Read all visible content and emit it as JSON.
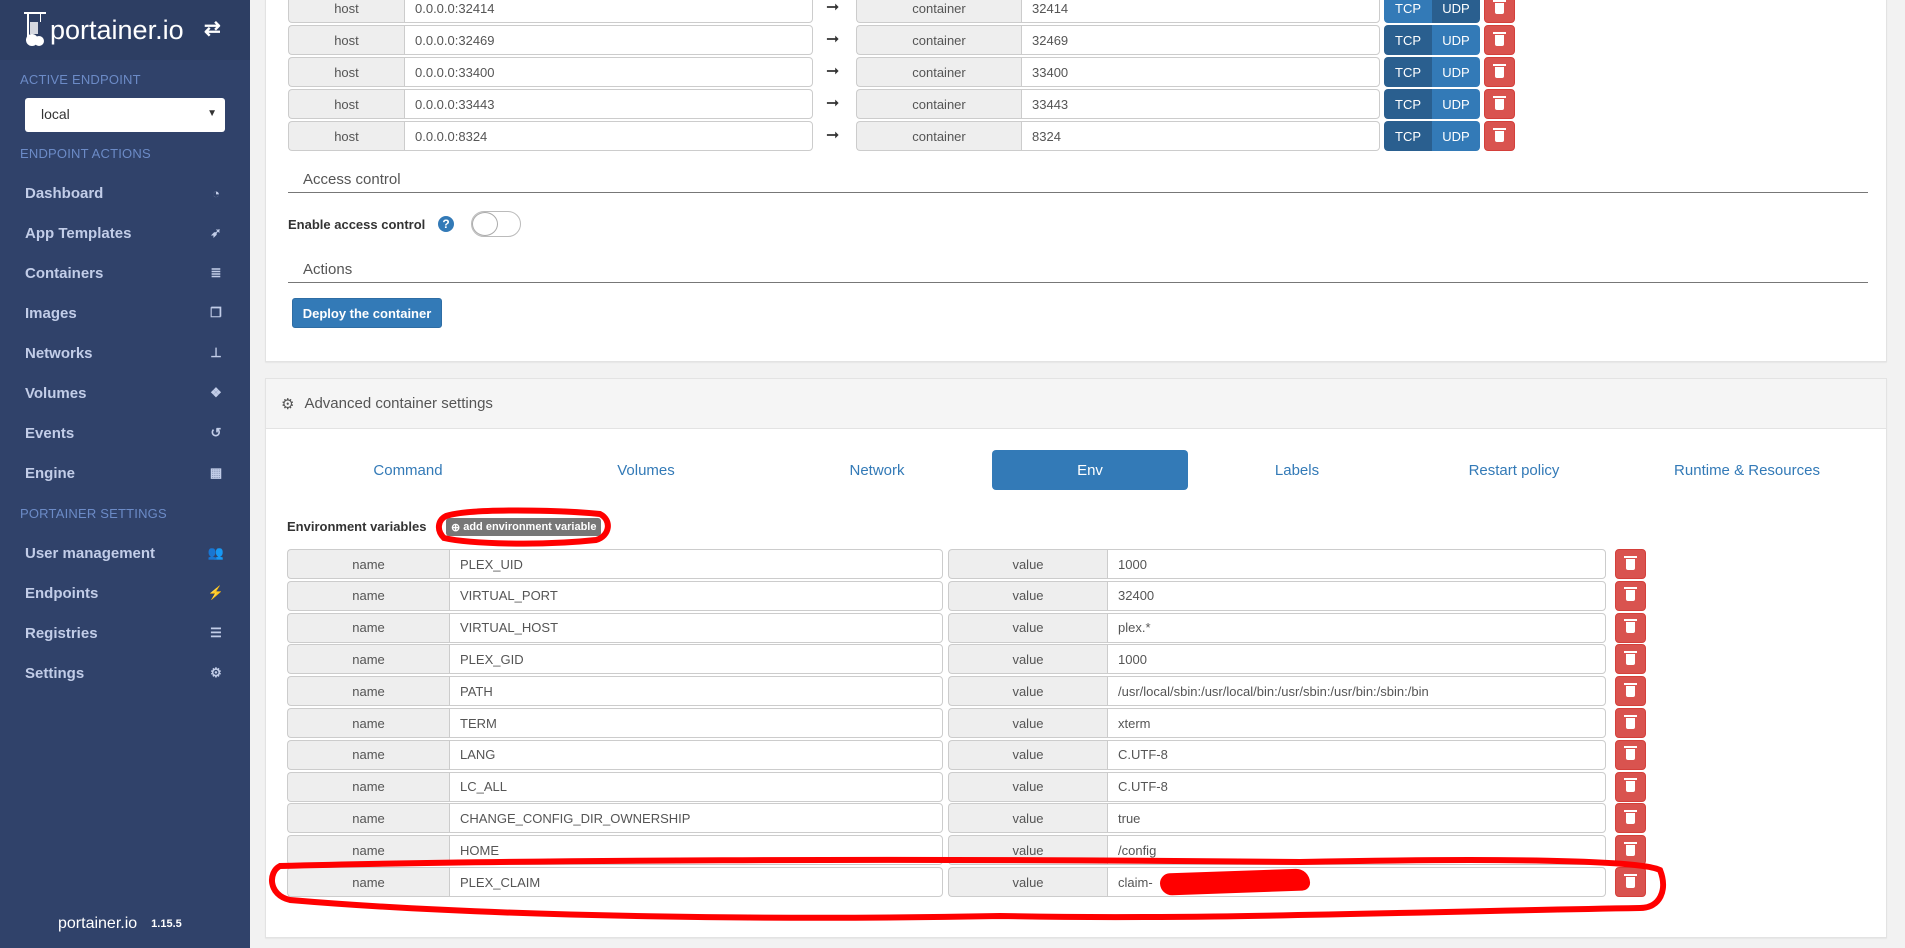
{
  "sidebar": {
    "brand": "portainer.io",
    "active_endpoint_title": "ACTIVE ENDPOINT",
    "endpoint_value": "local",
    "endpoint_actions_title": "ENDPOINT ACTIONS",
    "items": [
      {
        "label": "Dashboard",
        "icon": "tachometer-icon"
      },
      {
        "label": "App Templates",
        "icon": "rocket-icon"
      },
      {
        "label": "Containers",
        "icon": "server-icon"
      },
      {
        "label": "Images",
        "icon": "clone-icon"
      },
      {
        "label": "Networks",
        "icon": "sitemap-icon"
      },
      {
        "label": "Volumes",
        "icon": "cubes-icon"
      },
      {
        "label": "Events",
        "icon": "history-icon"
      },
      {
        "label": "Engine",
        "icon": "th-icon"
      }
    ],
    "settings_title": "PORTAINER SETTINGS",
    "settings_items": [
      {
        "label": "User management",
        "icon": "users-icon"
      },
      {
        "label": "Endpoints",
        "icon": "plug-icon"
      },
      {
        "label": "Registries",
        "icon": "database-icon"
      },
      {
        "label": "Settings",
        "icon": "cogs-icon"
      }
    ],
    "footer_brand": "portainer.io",
    "version": "1.15.5"
  },
  "ports": {
    "host_label": "host",
    "container_label": "container",
    "tcp": "TCP",
    "udp": "UDP",
    "rows": [
      {
        "host": "0.0.0.0:32414",
        "container": "32414",
        "protocol": "udp"
      },
      {
        "host": "0.0.0.0:32469",
        "container": "32469",
        "protocol": "tcp"
      },
      {
        "host": "0.0.0.0:33400",
        "container": "33400",
        "protocol": "tcp"
      },
      {
        "host": "0.0.0.0:33443",
        "container": "33443",
        "protocol": "tcp"
      },
      {
        "host": "0.0.0.0:8324",
        "container": "8324",
        "protocol": "tcp"
      }
    ]
  },
  "access_control": {
    "title": "Access control",
    "label": "Enable access control",
    "enabled": false
  },
  "actions": {
    "title": "Actions",
    "deploy_label": "Deploy the container"
  },
  "advanced": {
    "title": "Advanced container settings",
    "tabs": [
      "Command",
      "Volumes",
      "Network",
      "Env",
      "Labels",
      "Restart policy",
      "Runtime & Resources"
    ],
    "active_tab": "Env",
    "env_title": "Environment variables",
    "add_label": "add environment variable",
    "name_label": "name",
    "value_label": "value",
    "env": [
      {
        "name": "PLEX_UID",
        "value": "1000"
      },
      {
        "name": "VIRTUAL_PORT",
        "value": "32400"
      },
      {
        "name": "VIRTUAL_HOST",
        "value": "plex.*"
      },
      {
        "name": "PLEX_GID",
        "value": "1000"
      },
      {
        "name": "PATH",
        "value": "/usr/local/sbin:/usr/local/bin:/usr/sbin:/usr/bin:/sbin:/bin"
      },
      {
        "name": "TERM",
        "value": "xterm"
      },
      {
        "name": "LANG",
        "value": "C.UTF-8"
      },
      {
        "name": "LC_ALL",
        "value": "C.UTF-8"
      },
      {
        "name": "CHANGE_CONFIG_DIR_OWNERSHIP",
        "value": "true"
      },
      {
        "name": "HOME",
        "value": "/config"
      },
      {
        "name": "PLEX_CLAIM",
        "value": "claim-"
      }
    ]
  },
  "colors": {
    "sidebar": "#30426a",
    "primary": "#337ab7",
    "danger": "#d9534f",
    "annotation": "#ff0000"
  }
}
